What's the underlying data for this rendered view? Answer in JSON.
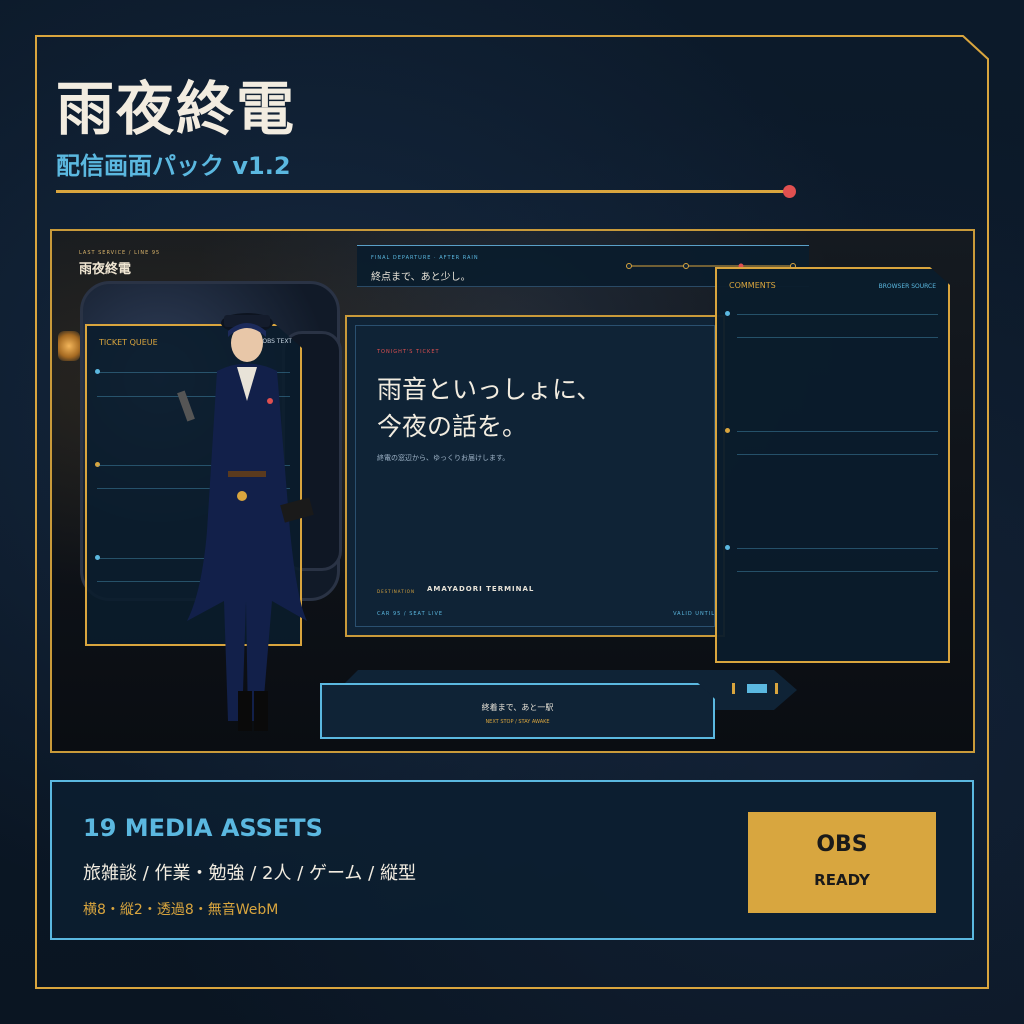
{
  "header": {
    "title": "雨夜終電",
    "subtitle": "配信画面パック v1.2"
  },
  "preview": {
    "brand_small": "LAST SERVICE / LINE 95",
    "brand": "雨夜終電",
    "ticket_queue": {
      "title": "TICKET QUEUE",
      "tag": "OBS TEXT"
    },
    "destination_bar": {
      "small": "FINAL DEPARTURE · AFTER RAIN",
      "main": "終点まで、あと少し。"
    },
    "main_card": {
      "label": "TONIGHT'S TICKET",
      "headline_line1": "雨音といっしょに、",
      "headline_line2": "今夜の話を。",
      "sub": "終電の窓辺から、ゆっくりお届けします。",
      "destination_label": "DESTINATION",
      "destination": "AMAYADORI TERMINAL",
      "footer_left": "CAR 95 / SEAT LIVE",
      "footer_right": "VALID UNTIL"
    },
    "comments": {
      "title": "COMMENTS",
      "tag": "BROWSER SOURCE"
    },
    "next_stop": {
      "main": "終着まで、あと一駅",
      "sub": "NEXT STOP / STAY AWAKE"
    }
  },
  "info": {
    "count": "19 MEDIA ASSETS",
    "genres": "旅雑談 / 作業・勉強 / 2人 / ゲーム / 縦型",
    "specs": "横8・縦2・透過8・無音WebM",
    "obs_main": "OBS",
    "obs_sub": "READY"
  },
  "colors": {
    "gold": "#d9a53e",
    "blue": "#5bb8e0",
    "red": "#e05050",
    "navy": "#0f2336"
  }
}
